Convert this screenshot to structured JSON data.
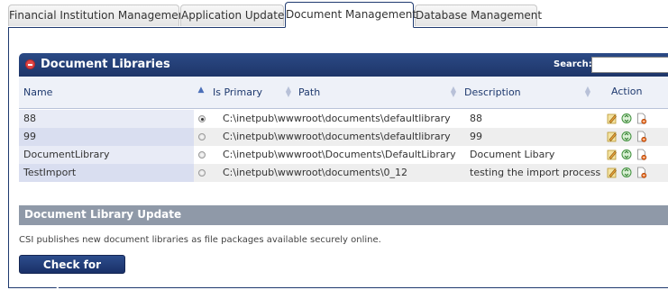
{
  "tabs": [
    {
      "label": "Financial Institution Management",
      "active": false
    },
    {
      "label": "Application Update",
      "active": false
    },
    {
      "label": "Document Management",
      "active": true
    },
    {
      "label": "Database Management",
      "active": false
    }
  ],
  "libraries": {
    "title": "Document Libraries",
    "search_label": "Search:",
    "search_value": "",
    "columns": {
      "name": "Name",
      "is_primary": "Is Primary",
      "path": "Path",
      "description": "Description",
      "action": "Action"
    },
    "sorted_column": "name",
    "rows": [
      {
        "name": "88",
        "is_primary": true,
        "path": "C:\\inetpub\\wwwroot\\documents\\defaultlibrary",
        "description": "88"
      },
      {
        "name": "99",
        "is_primary": false,
        "path": "C:\\inetpub\\wwwroot\\documents\\defaultlibrary",
        "description": "99"
      },
      {
        "name": "DocumentLibrary",
        "is_primary": false,
        "path": "C:\\inetpub\\wwwroot\\Documents\\DefaultLibrary",
        "description": "Document Libary"
      },
      {
        "name": "TestImport",
        "is_primary": false,
        "path": "C:\\inetpub\\wwwroot\\documents\\0_12",
        "description": "testing the import process"
      }
    ],
    "action_icons": [
      "edit-icon",
      "sync-icon",
      "delete-document-icon"
    ]
  },
  "update": {
    "title": "Document Library Update",
    "description": "CSI publishes new document libraries as file packages available securely online.",
    "button_label": "Check for Updates"
  },
  "colors": {
    "header_navy": "#1f3a6f",
    "update_header_gray": "#8f99a8",
    "collapse_red": "#e04545"
  }
}
